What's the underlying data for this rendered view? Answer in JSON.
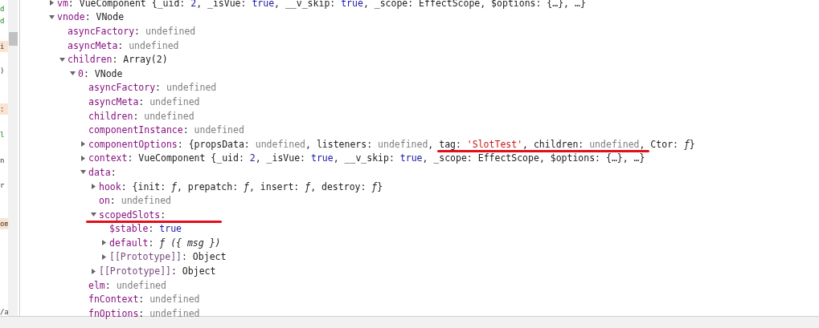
{
  "side_panel": {
    "fragments": [
      {
        "text": "d",
        "kind": "green"
      },
      {
        "text": "d",
        "kind": "green"
      },
      {
        "text": "i",
        "kind": "highlight"
      },
      {
        "text": ")",
        "kind": "plain"
      },
      {
        "text": ":",
        "kind": "highlight"
      },
      {
        "text": "l",
        "kind": "green"
      },
      {
        "text": "n",
        "kind": "plain"
      },
      {
        "text": "r",
        "kind": "plain"
      },
      {
        "text": "om",
        "kind": "highlight"
      },
      {
        "text": "/a",
        "kind": "plain"
      }
    ]
  },
  "tree": [
    {
      "expanded": false,
      "expandable": true,
      "segments": [
        {
          "text": "vm",
          "kind": "key"
        },
        {
          "text": ": VueComponent {_uid: ",
          "kind": "plain"
        },
        {
          "text": "2",
          "kind": "keyword"
        },
        {
          "text": ", _isVue: ",
          "kind": "plain"
        },
        {
          "text": "true",
          "kind": "keyword"
        },
        {
          "text": ", __v_skip: ",
          "kind": "plain"
        },
        {
          "text": "true",
          "kind": "keyword"
        },
        {
          "text": ", _scope: EffectScope, $options: {…}, …}",
          "kind": "plain"
        }
      ]
    },
    {
      "expanded": true,
      "expandable": true,
      "segments": [
        {
          "text": "vnode",
          "kind": "key"
        },
        {
          "text": ": VNode",
          "kind": "plain"
        }
      ],
      "children": [
        {
          "expandable": false,
          "segments": [
            {
              "text": "asyncFactory",
              "kind": "key"
            },
            {
              "text": ": ",
              "kind": "plain"
            },
            {
              "text": "undefined",
              "kind": "dim"
            }
          ]
        },
        {
          "expandable": false,
          "segments": [
            {
              "text": "asyncMeta",
              "kind": "key"
            },
            {
              "text": ": ",
              "kind": "plain"
            },
            {
              "text": "undefined",
              "kind": "dim"
            }
          ]
        },
        {
          "expanded": true,
          "expandable": true,
          "segments": [
            {
              "text": "children",
              "kind": "key"
            },
            {
              "text": ": Array(2)",
              "kind": "plain"
            }
          ],
          "children": [
            {
              "expanded": true,
              "expandable": true,
              "segments": [
                {
                  "text": "0",
                  "kind": "key"
                },
                {
                  "text": ": VNode",
                  "kind": "plain"
                }
              ],
              "children": [
                {
                  "expandable": false,
                  "segments": [
                    {
                      "text": "asyncFactory",
                      "kind": "key"
                    },
                    {
                      "text": ": ",
                      "kind": "plain"
                    },
                    {
                      "text": "undefined",
                      "kind": "dim"
                    }
                  ]
                },
                {
                  "expandable": false,
                  "segments": [
                    {
                      "text": "asyncMeta",
                      "kind": "key"
                    },
                    {
                      "text": ": ",
                      "kind": "plain"
                    },
                    {
                      "text": "undefined",
                      "kind": "dim"
                    }
                  ]
                },
                {
                  "expandable": false,
                  "segments": [
                    {
                      "text": "children",
                      "kind": "key"
                    },
                    {
                      "text": ": ",
                      "kind": "plain"
                    },
                    {
                      "text": "undefined",
                      "kind": "dim"
                    }
                  ]
                },
                {
                  "expandable": false,
                  "segments": [
                    {
                      "text": "componentInstance",
                      "kind": "key"
                    },
                    {
                      "text": ": ",
                      "kind": "plain"
                    },
                    {
                      "text": "undefined",
                      "kind": "dim"
                    }
                  ]
                },
                {
                  "expanded": false,
                  "expandable": true,
                  "segments": [
                    {
                      "text": "componentOptions",
                      "kind": "key"
                    },
                    {
                      "text": ": {propsData: ",
                      "kind": "plain"
                    },
                    {
                      "text": "undefined",
                      "kind": "dim"
                    },
                    {
                      "text": ", listeners: ",
                      "kind": "plain"
                    },
                    {
                      "text": "undefined",
                      "kind": "dim"
                    },
                    {
                      "text": ", ",
                      "kind": "plain"
                    },
                    {
                      "text": "tag: ",
                      "kind": "plain",
                      "underlined": true
                    },
                    {
                      "text": "'SlotTest'",
                      "kind": "string",
                      "underlined": true
                    },
                    {
                      "text": ", children: ",
                      "kind": "plain",
                      "underlined": true
                    },
                    {
                      "text": "undefined",
                      "kind": "dim",
                      "underlined": true
                    },
                    {
                      "text": ",",
                      "kind": "plain",
                      "underlined": true
                    },
                    {
                      "text": " Ctor: ",
                      "kind": "plain"
                    },
                    {
                      "text": "ƒ",
                      "kind": "italic"
                    },
                    {
                      "text": "}",
                      "kind": "plain"
                    }
                  ]
                },
                {
                  "expanded": false,
                  "expandable": true,
                  "segments": [
                    {
                      "text": "context",
                      "kind": "key"
                    },
                    {
                      "text": ": VueComponent {_uid: ",
                      "kind": "plain"
                    },
                    {
                      "text": "2",
                      "kind": "keyword"
                    },
                    {
                      "text": ", _isVue: ",
                      "kind": "plain"
                    },
                    {
                      "text": "true",
                      "kind": "keyword"
                    },
                    {
                      "text": ", __v_skip: ",
                      "kind": "plain"
                    },
                    {
                      "text": "true",
                      "kind": "keyword"
                    },
                    {
                      "text": ", _scope: EffectScope, $options: {…}, …}",
                      "kind": "plain"
                    }
                  ]
                },
                {
                  "expanded": true,
                  "expandable": true,
                  "segments": [
                    {
                      "text": "data",
                      "kind": "key"
                    },
                    {
                      "text": ":",
                      "kind": "plain"
                    }
                  ],
                  "children": [
                    {
                      "expanded": false,
                      "expandable": true,
                      "segments": [
                        {
                          "text": "hook",
                          "kind": "key"
                        },
                        {
                          "text": ": {init: ",
                          "kind": "plain"
                        },
                        {
                          "text": "ƒ",
                          "kind": "italic"
                        },
                        {
                          "text": ", prepatch: ",
                          "kind": "plain"
                        },
                        {
                          "text": "ƒ",
                          "kind": "italic"
                        },
                        {
                          "text": ", insert: ",
                          "kind": "plain"
                        },
                        {
                          "text": "ƒ",
                          "kind": "italic"
                        },
                        {
                          "text": ", destroy: ",
                          "kind": "plain"
                        },
                        {
                          "text": "ƒ",
                          "kind": "italic"
                        },
                        {
                          "text": "}",
                          "kind": "plain"
                        }
                      ]
                    },
                    {
                      "expandable": false,
                      "segments": [
                        {
                          "text": "on",
                          "kind": "key"
                        },
                        {
                          "text": ": ",
                          "kind": "plain"
                        },
                        {
                          "text": "undefined",
                          "kind": "dim"
                        }
                      ]
                    },
                    {
                      "expanded": true,
                      "expandable": true,
                      "underlined": true,
                      "segments": [
                        {
                          "text": "scopedSlots",
                          "kind": "key"
                        },
                        {
                          "text": ":",
                          "kind": "plain"
                        }
                      ],
                      "children": [
                        {
                          "expandable": false,
                          "segments": [
                            {
                              "text": "$stable",
                              "kind": "key"
                            },
                            {
                              "text": ": ",
                              "kind": "plain"
                            },
                            {
                              "text": "true",
                              "kind": "keyword"
                            }
                          ]
                        },
                        {
                          "expanded": false,
                          "expandable": true,
                          "segments": [
                            {
                              "text": "default",
                              "kind": "key"
                            },
                            {
                              "text": ": ",
                              "kind": "plain"
                            },
                            {
                              "text": "ƒ ({ msg })",
                              "kind": "italic"
                            }
                          ]
                        },
                        {
                          "expanded": false,
                          "expandable": true,
                          "segments": [
                            {
                              "text": "[[Prototype]]",
                              "kind": "dimkey"
                            },
                            {
                              "text": ": Object",
                              "kind": "plain"
                            }
                          ]
                        }
                      ]
                    },
                    {
                      "expanded": false,
                      "expandable": true,
                      "segments": [
                        {
                          "text": "[[Prototype]]",
                          "kind": "dimkey"
                        },
                        {
                          "text": ": Object",
                          "kind": "plain"
                        }
                      ]
                    }
                  ]
                },
                {
                  "expandable": false,
                  "segments": [
                    {
                      "text": "elm",
                      "kind": "key"
                    },
                    {
                      "text": ": ",
                      "kind": "plain"
                    },
                    {
                      "text": "undefined",
                      "kind": "dim"
                    }
                  ]
                },
                {
                  "expandable": false,
                  "segments": [
                    {
                      "text": "fnContext",
                      "kind": "key"
                    },
                    {
                      "text": ": ",
                      "kind": "plain"
                    },
                    {
                      "text": "undefined",
                      "kind": "dim"
                    }
                  ]
                },
                {
                  "expandable": false,
                  "segments": [
                    {
                      "text": "fnOptions",
                      "kind": "key"
                    },
                    {
                      "text": ": ",
                      "kind": "plain"
                    },
                    {
                      "text": "undefined",
                      "kind": "dim"
                    }
                  ]
                }
              ]
            }
          ]
        }
      ]
    }
  ]
}
